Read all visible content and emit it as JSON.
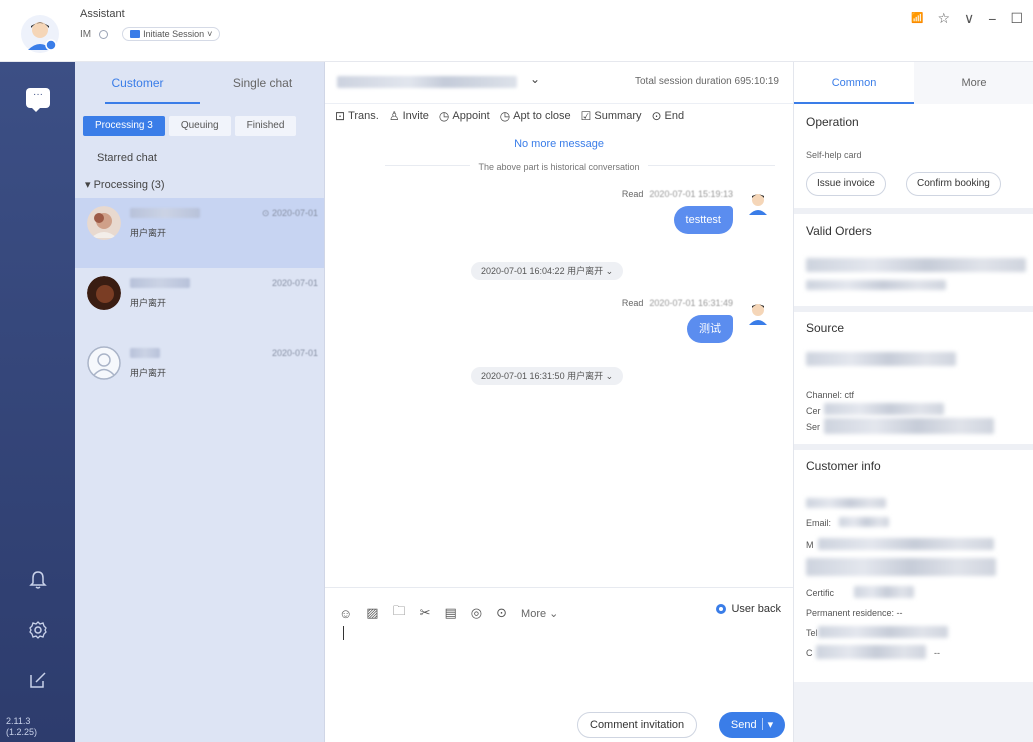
{
  "app": {
    "title": "Assistant",
    "im_label": "IM",
    "session_button": "Initiate Session",
    "session_chevron": "˅",
    "version_line1": "2.11.3",
    "version_line2": "(1.2.25)"
  },
  "window_controls": {
    "signal": "📶",
    "pin": "☆",
    "dropdown": "∨",
    "minimize": "−",
    "maximize": "☐"
  },
  "list": {
    "tabs": [
      {
        "label": "Customer",
        "active": true
      },
      {
        "label": "Single chat",
        "active": false
      }
    ],
    "filters": [
      {
        "label": "Processing 3",
        "active": true
      },
      {
        "label": "Queuing",
        "active": false
      },
      {
        "label": "Finished",
        "active": false
      }
    ],
    "starred_label": "Starred chat",
    "group_label": "▾ Processing (3)",
    "items": [
      {
        "message": "用户离开",
        "time": "⊙ 2020-07-01",
        "selected": true
      },
      {
        "message": "用户离开",
        "time": "2020-07-01",
        "selected": false
      },
      {
        "message": "用户离开",
        "time": "2020-07-01",
        "selected": false
      }
    ]
  },
  "chat": {
    "header_chevron": "⌄",
    "duration": "Total session duration 695:10:19",
    "toolbar": [
      {
        "icon": "⊡",
        "label": "Trans."
      },
      {
        "icon": "♙",
        "label": "Invite"
      },
      {
        "icon": "◷",
        "label": "Appoint"
      },
      {
        "icon": "◷",
        "label": "Apt to close"
      },
      {
        "icon": "☑",
        "label": "Summary"
      },
      {
        "icon": "⊙",
        "label": "End"
      }
    ],
    "no_more": "No more message",
    "history_note": "The above part is historical conversation",
    "messages": [
      {
        "read": "Read",
        "time": "2020-07-01 15:19:13",
        "text": "testtest"
      },
      {
        "read": "Read",
        "time": "2020-07-01 16:31:49",
        "text": "测试"
      }
    ],
    "system_notes": [
      "2020-07-01 16:04:22 用户离开 ⌄",
      "2020-07-01 16:31:50 用户离开 ⌄"
    ],
    "input_tools": [
      "☺",
      "▨",
      "🗀",
      "✂",
      "▤",
      "◎",
      "⊙"
    ],
    "more_label": "More ⌄",
    "user_back": "User back",
    "comment_btn": "Comment invitation",
    "send_btn": "Send",
    "send_arrow": "▾"
  },
  "info": {
    "tabs": [
      {
        "label": "Common",
        "active": true
      },
      {
        "label": "More",
        "active": false
      }
    ],
    "operation_title": "Operation",
    "selfhelp_label": "Self-help card",
    "card_buttons": [
      "Issue invoice",
      "Confirm booking"
    ],
    "orders_title": "Valid Orders",
    "source_title": "Source",
    "source_channel": "Channel:",
    "source_channel_value": "ctf",
    "source_label_2": "Cer",
    "source_label_3": "Ser",
    "customer_title": "Customer info",
    "customer_label_1": "Email:",
    "customer_label_2": "M",
    "customer_label_3": "Certific",
    "customer_residence": "Permanent residence: --",
    "customer_label_5": "Tel",
    "customer_label_6": "C",
    "customer_dash": "--"
  }
}
